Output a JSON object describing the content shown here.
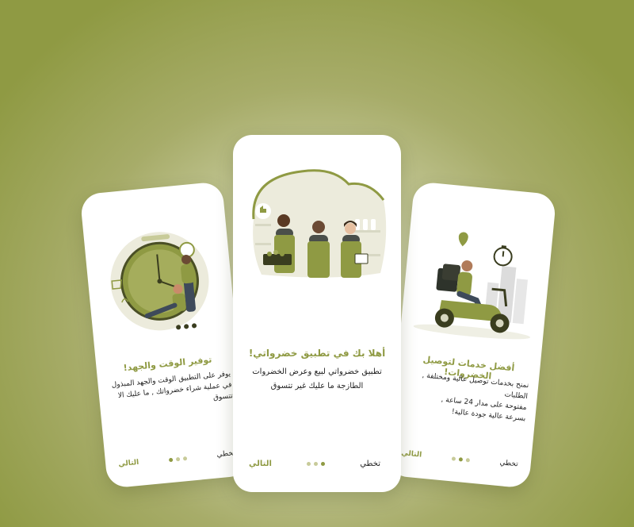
{
  "colors": {
    "accent": "#8f9a43",
    "dot_inactive": "#c8cb99",
    "text": "#222222",
    "card": "#ffffff"
  },
  "screens": {
    "left": {
      "illustration": "clock-time-saving-illustration",
      "title": "توفير الوقت والجهد!",
      "body": "يوفر على التطبيق الوقت والجهد المبذول\nفي عملية شراء خضرواتك , ما عليك الا\nتتسوق",
      "next_label": "التالي",
      "skip_label": "تخطي",
      "active_dot": 0
    },
    "center": {
      "illustration": "grocery-staff-illustration",
      "title": "أهلا بك في تطبيق خضرواتي!",
      "body": "تطبيق خضرواتي لبيع وعرض الخضروات\nالطازجة ما عليك غير تتسوق",
      "next_label": "التالي",
      "skip_label": "تخطي",
      "active_dot": 2
    },
    "right": {
      "illustration": "scooter-delivery-illustration",
      "title": "أفضل خدمات لتوصيل الخضروات!",
      "body": "نمنح بخدمات توصيل عالية ومختلفة , الطلبات\nمفتوحة على مدار 24 ساعة ,\nبسرعة عالية جودة عالية!",
      "next_label": "التالي",
      "skip_label": "تخطي",
      "active_dot": 1
    }
  }
}
